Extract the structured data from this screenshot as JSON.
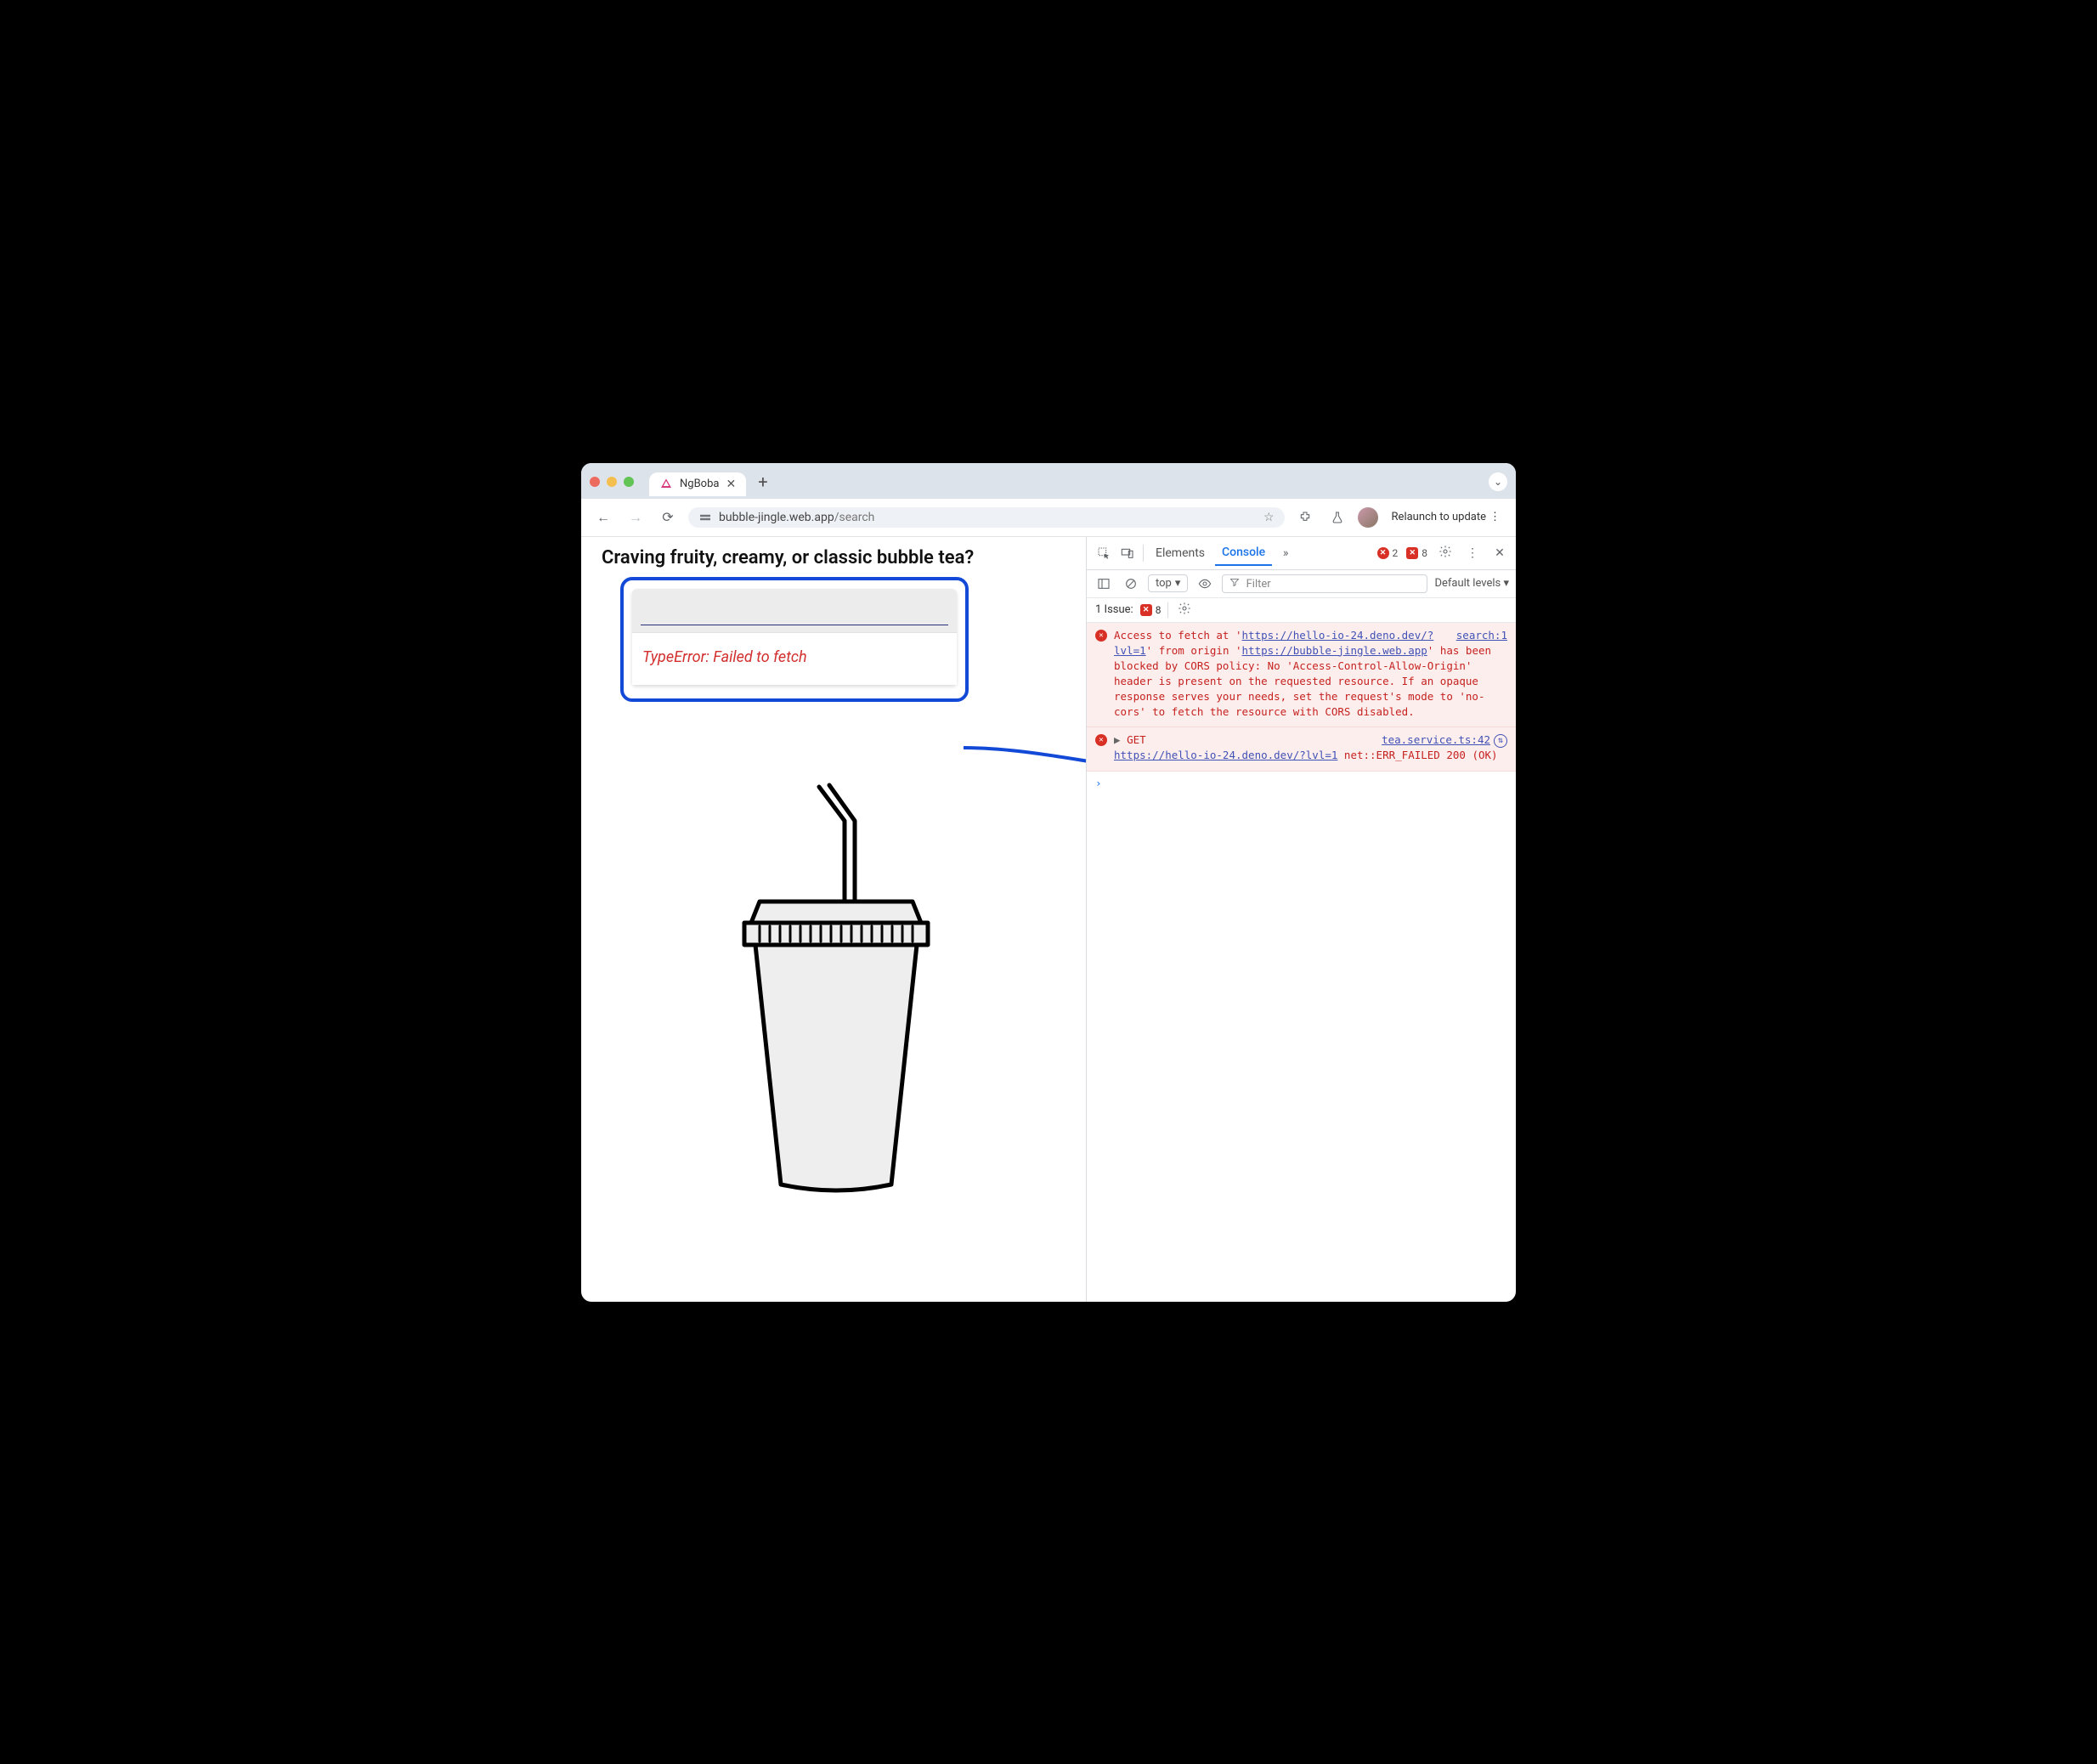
{
  "browser": {
    "tab_title": "NgBoba",
    "url_host": "bubble-jingle.web.app",
    "url_path": "/search",
    "relaunch_label": "Relaunch to update"
  },
  "page": {
    "heading": "Craving fruity, creamy, or classic bubble tea?",
    "input_value": "",
    "error_text": "TypeError: Failed to fetch"
  },
  "devtools": {
    "tabs": {
      "elements": "Elements",
      "console": "Console"
    },
    "error_count": "2",
    "issue_count": "8",
    "sub": {
      "context": "top",
      "filter_placeholder": "Filter",
      "levels": "Default levels"
    },
    "issues_bar": {
      "label": "1 Issue:",
      "count": "8"
    },
    "entry1": {
      "pre": "Access to fetch at '",
      "url1": "https://hello-io-24.deno.dev/?lvl=1",
      "mid": "' from origin '",
      "url2": "https://bubble-jingle.web.app",
      "post": "' has been blocked by CORS policy: No 'Access-Control-Allow-Origin' header is present on the requested resource. If an opaque response serves your needs, set the request's mode to 'no-cors' to fetch the resource with CORS disabled.",
      "source": "search:1"
    },
    "entry2": {
      "method": "GET",
      "url": "https://hello-io-24.deno.dev/?lvl=1",
      "tail": " net::ERR_FAILED 200 (OK)",
      "source": "tea.service.ts:42"
    }
  }
}
